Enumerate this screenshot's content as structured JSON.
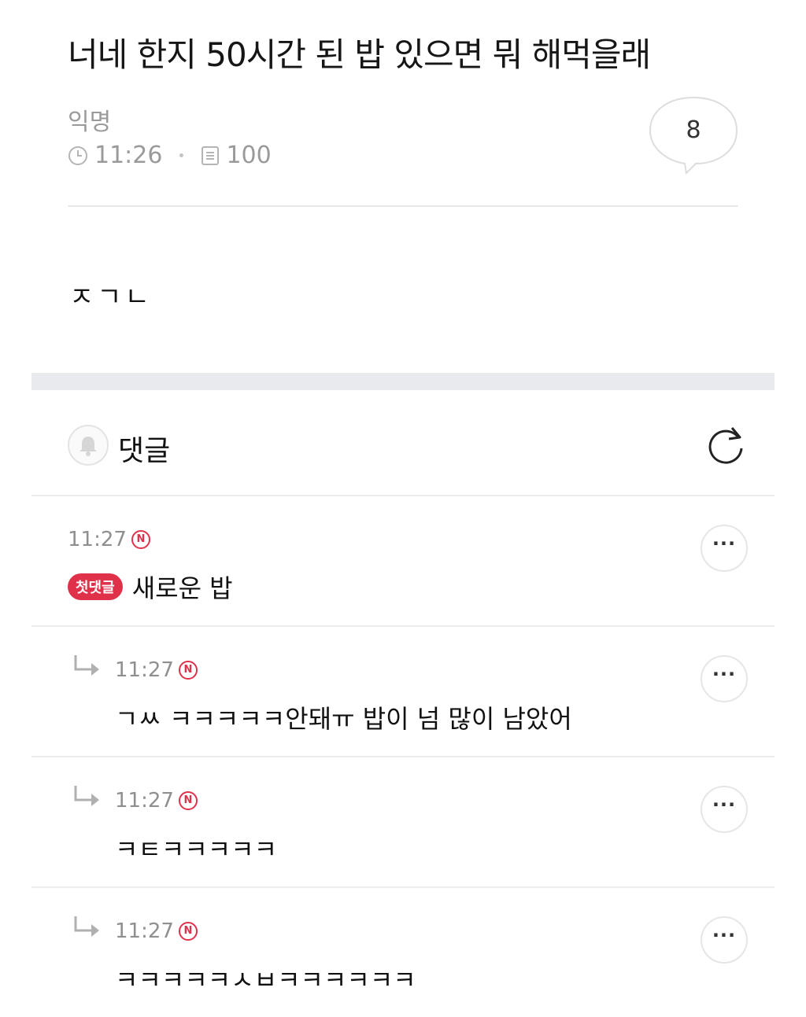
{
  "post": {
    "title": "너네 한지 50시간 된 밥 있으면 뭐 해먹을래",
    "author": "익명",
    "time": "11:26",
    "views": "100",
    "comment_count": "8",
    "body": "ㅈㄱㄴ"
  },
  "comments_section": {
    "label": "댓글"
  },
  "comments": [
    {
      "time": "11:27",
      "new_badge": "N",
      "first_badge": "첫댓글",
      "text": "새로운 밥",
      "is_reply": false
    },
    {
      "time": "11:27",
      "new_badge": "N",
      "text": "ㄱㅆ ㅋㅋㅋㅋㅋ안돼ㅠ 밥이 넘 많이 남았어",
      "is_reply": true
    },
    {
      "time": "11:27",
      "new_badge": "N",
      "text": "ㅋㅌㅋㅋㅋㅋㅋ",
      "is_reply": true
    },
    {
      "time": "11:27",
      "new_badge": "N",
      "text": "ㅋㅋㅋㅋㅋㅅㅂㅋㅋㅋㅋㅋㅋ",
      "is_reply": true
    }
  ],
  "more_label": "···",
  "colors": {
    "accent_red": "#e0314b",
    "meta_gray": "#9a9a9a",
    "band_gray": "#e9eaee"
  },
  "icons": [
    "clock-icon",
    "document-icon",
    "speech-bubble-icon",
    "bell-icon",
    "refresh-icon",
    "reply-arrow-icon",
    "more-icon"
  ]
}
